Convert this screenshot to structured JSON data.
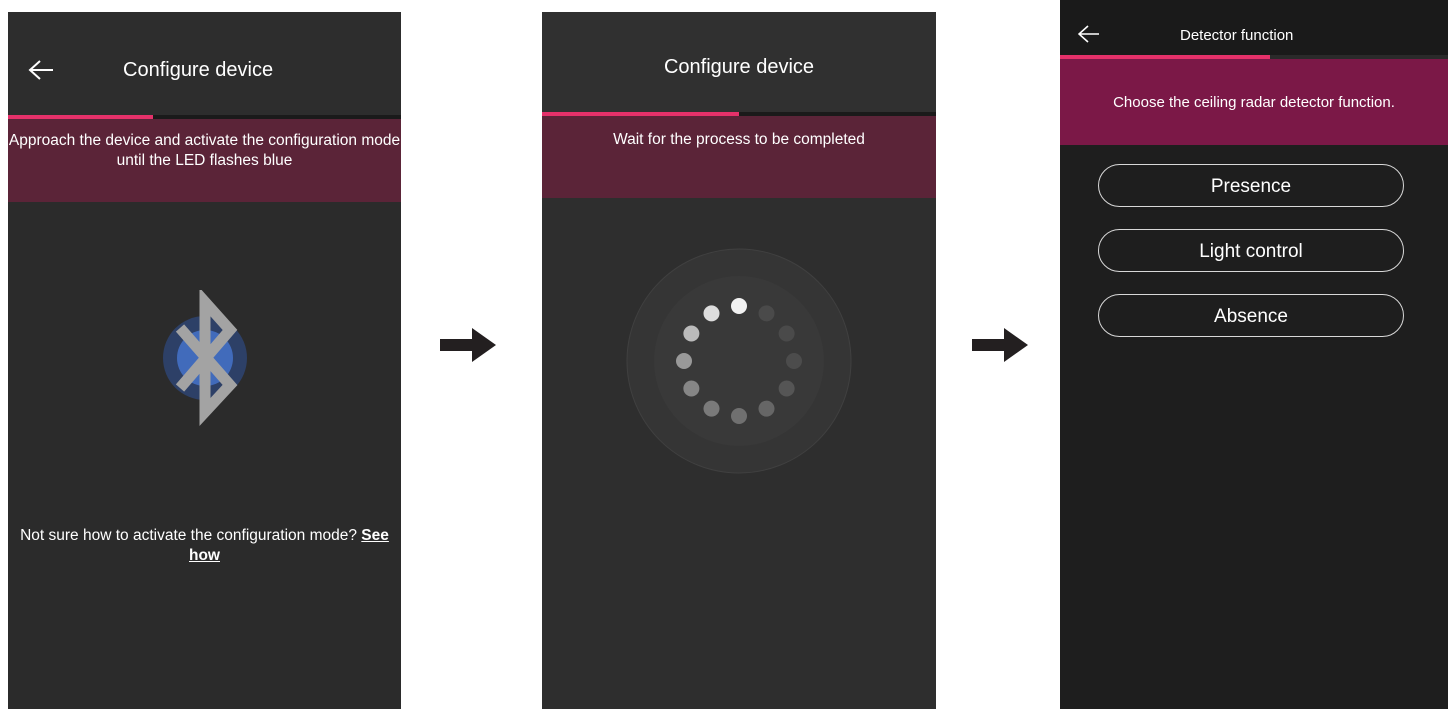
{
  "screen1": {
    "title": "Configure device",
    "progress": 0.37,
    "instruction": "Approach the device and activate the configuration mode until the LED flashes blue",
    "icon": "bluetooth-icon",
    "hint_text": "Not sure how to activate the configuration mode?",
    "hint_link": "See how"
  },
  "screen2": {
    "title": "Configure device",
    "progress": 0.5,
    "status": "Wait for the process to be completed",
    "icon": "loading-spinner"
  },
  "screen3": {
    "title": "Detector function",
    "progress": 0.54,
    "instruction": "Choose the ceiling radar detector function.",
    "options": [
      "Presence",
      "Light control",
      "Absence"
    ]
  },
  "colors": {
    "accent": "#e5316a",
    "banner": "#5b2438",
    "banner_active": "#7b1847",
    "background": "#2b2b2b"
  },
  "flow_arrow_icon": "arrow-right-icon"
}
